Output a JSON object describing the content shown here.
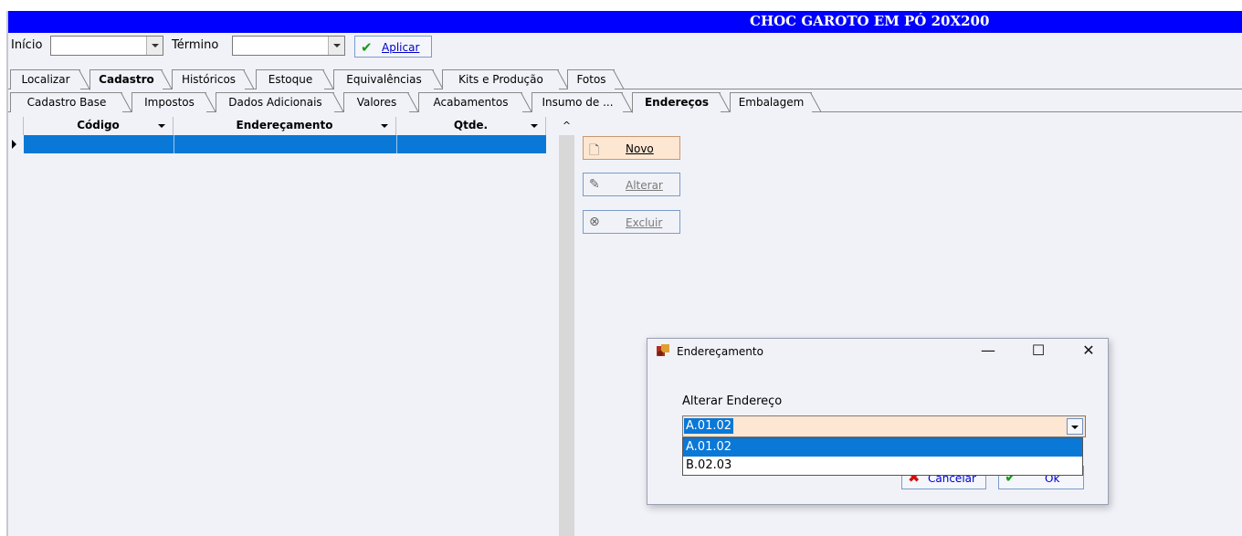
{
  "window": {
    "title": "CHOC GAROTO EM PÓ 20X200"
  },
  "filter": {
    "start_label": "Início",
    "end_label": "Término",
    "apply_label": "Aplicar"
  },
  "main_tabs": [
    "Localizar",
    "Cadastro",
    "Históricos",
    "Estoque",
    "Equivalências",
    "Kits e Produção",
    "Fotos"
  ],
  "main_tabs_active": "Cadastro",
  "sub_tabs": [
    "Cadastro Base",
    "Impostos",
    "Dados Adicionais",
    "Valores",
    "Acabamentos",
    "Insumo de ...",
    "Endereços",
    "Embalagem"
  ],
  "sub_tabs_active": "Endereços",
  "grid": {
    "columns": [
      "Código",
      "Endereçamento",
      "Qtde."
    ],
    "rows": [
      [
        "",
        "",
        ""
      ]
    ],
    "scroll_up": "^"
  },
  "side_buttons": {
    "new_label": "Novo",
    "edit_label": "Alterar",
    "delete_label": "Excluir"
  },
  "dialog": {
    "title": "Endereçamento",
    "minimize": "—",
    "maximize": "☐",
    "close": "✕",
    "field_label": "Alterar Endereço",
    "selected_value": "A.01.02",
    "options": [
      "A.01.02",
      "B.02.03"
    ],
    "cancel_label": "Cancelar",
    "ok_label": "Ok"
  },
  "colors": {
    "title_bar": "#0000ff",
    "selection": "#0a78d7",
    "field_highlight": "#fde6d2"
  }
}
